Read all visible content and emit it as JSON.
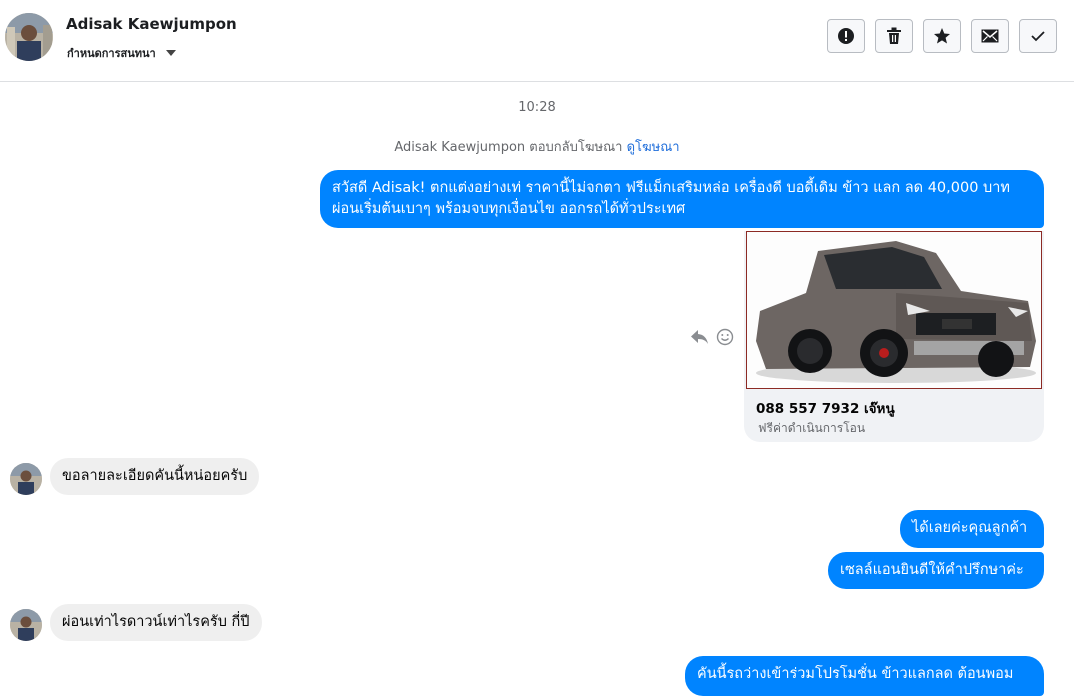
{
  "header": {
    "name": "Adisak Kaewjumpon",
    "subtitle": "กำหนดการสนทนา"
  },
  "toolbar": [
    {
      "name": "report-button",
      "icon": "exclamation-icon"
    },
    {
      "name": "delete-button",
      "icon": "trash-icon"
    },
    {
      "name": "star-button",
      "icon": "star-icon"
    },
    {
      "name": "mark-unread-button",
      "icon": "envelope-icon"
    },
    {
      "name": "done-button",
      "icon": "check-icon"
    }
  ],
  "thread": {
    "timestamp": "10:28",
    "ad_reply_text": "Adisak Kaewjumpon ตอบกลับโฆษณา",
    "ad_link": "ดูโฆษณา",
    "messages": {
      "ad_line1": "สวัสดี Adisak! ตกแต่งอย่างเท่ ราคานี้ไม่จกตา ฟรีแม็กเสริมหล่อ เครื่องดี บอดี้เดิม ข้าว แลก ลด 40,000 บาท",
      "ad_line2": "ผ่อนเริ่มต้นเบาๆ พร้อมจบทุกเงื่อนไข ออกรถได้ทั่วประเทศ",
      "card_title": "088 557 7932 เจ๊หนู",
      "card_subtitle": "ฟรีค่าดำเนินการโอน",
      "in1": "ขอลายละเอียดคันนี้หน่อยครับ",
      "out1": "ได้เลยค่ะคุณลูกค้า",
      "out2": "เซลล์แอนยินดีให้คำปรึกษาค่ะ",
      "in2": "ผ่อนเท่าไรดาวน์เท่าไรครับ กี่ปี",
      "out3": "คันนี้รถว่างเข้าร่วมโปรโมชั่น ข้าวแลกลด ต้อนพอม"
    }
  },
  "colors": {
    "outgoing": "#0084ff",
    "incoming": "#efefef",
    "link": "#216fdb"
  }
}
